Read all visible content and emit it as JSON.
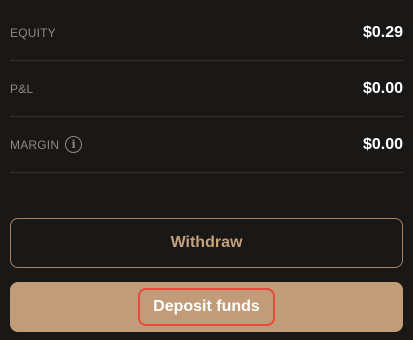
{
  "summary": {
    "equity": {
      "label": "EQUITY",
      "value": "$0.29"
    },
    "pnl": {
      "label": "P&L",
      "value": "$0.00"
    },
    "margin": {
      "label": "MARGIN",
      "value": "$0.00",
      "info_icon": "info-icon"
    }
  },
  "actions": {
    "withdraw_label": "Withdraw",
    "deposit_label": "Deposit funds"
  },
  "colors": {
    "background": "#1a1816",
    "accent": "#c29c78",
    "highlight": "#e8493a"
  }
}
